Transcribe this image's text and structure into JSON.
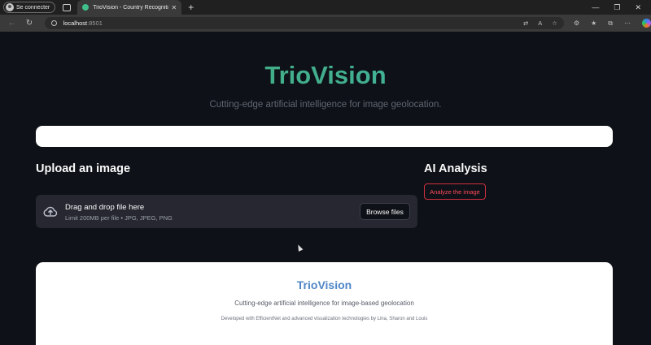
{
  "browser": {
    "profile_label": "Se connecter",
    "tab_title": "TrioVision - Country Recognition",
    "url_host": "localhost",
    "url_port": ":8501"
  },
  "hero": {
    "title": "TrioVision",
    "subtitle": "Cutting-edge artificial intelligence for image geolocation."
  },
  "upload": {
    "heading": "Upload an image",
    "drop_text": "Drag and drop file here",
    "limit_text": "Limit 200MB per file • JPG, JPEG, PNG",
    "browse_label": "Browse files"
  },
  "analysis": {
    "heading": "AI Analysis",
    "button_label": "Analyze the image"
  },
  "footer": {
    "title": "TrioVision",
    "subtitle": "Cutting-edge artificial intelligence for image-based geolocation",
    "credit": "Developed with EfficientNet and advanced visualization technologies by Lina, Sharon and Louis"
  },
  "colors": {
    "background": "#0e1117",
    "accent_green": "#3fa873",
    "footer_title_blue": "#4f86c6",
    "danger": "#ff4b5c"
  }
}
